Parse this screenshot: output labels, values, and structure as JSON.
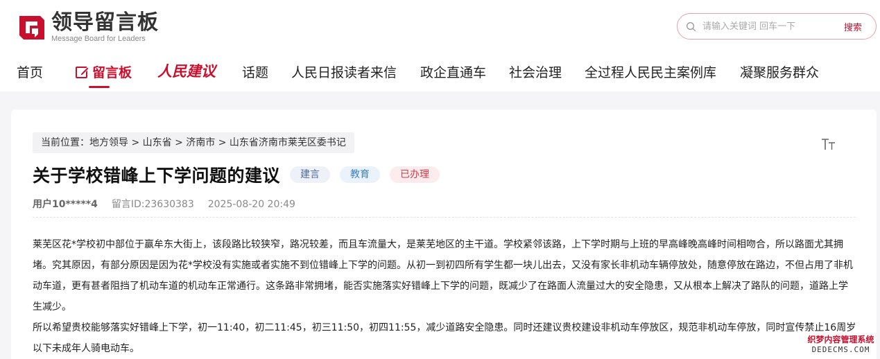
{
  "header": {
    "logo_title": "领导留言板",
    "logo_subtitle": "Message Board for Leaders",
    "search": {
      "placeholder": "请输入关键词 回车一下",
      "button": "搜索"
    }
  },
  "nav": {
    "items": [
      {
        "label": "首页"
      },
      {
        "label": "留言板",
        "active": true
      },
      {
        "label": "人民建议"
      },
      {
        "label": "话题"
      },
      {
        "label": "人民日报读者来信"
      },
      {
        "label": "政企直通车"
      },
      {
        "label": "社会治理"
      },
      {
        "label": "全过程人民民主案例库"
      },
      {
        "label": "凝聚服务群众"
      }
    ]
  },
  "breadcrumb": {
    "prefix": "当前位置：",
    "items": [
      "地方领导",
      "山东省",
      "济南市",
      "山东省济南市莱芜区委书记"
    ],
    "separator": " > "
  },
  "message": {
    "title": "关于学校错峰上下学问题的建议",
    "tags": [
      "建言",
      "教育",
      "已办理"
    ],
    "user": "用户10*****4",
    "message_id": "留言ID:23630383",
    "datetime": "2025-08-20 20:49",
    "paragraphs": [
      "莱芜区花*学校初中部位于赢牟东大街上，该段路比较狭窄，路况较差，而且车流量大，是莱芜地区的主干道。学校紧邻该路，上下学时期与上班的早高峰晚高峰时间相吻合，所以路面尤其拥堵。究其原因，有部分原因是因为花*学校没有实施或者实施不到位错峰上下学的问题。从初一到初四所有学生都一块儿出去，又没有家长非机动车辆停放处，随意停放在路边，不但占用了非机动车道，更有甚者阻挡了机动车道的机动车正常通行。这条路非常拥堵，能否实施落实好错峰上下学的问题，既减少了在路面人流量过大的安全隐患，又从根本上解决了路队的问题，道路上学生减少。",
      "所以希望贵校能够落实好错峰上下学，初一11:40，初二11:45，初三11:50，初四11:55，减少道路安全隐患。同时还建议贵校建设非机动车停放区，规范非机动车停放，同时宣传禁止16周岁以下未成年人骑电动车。"
    ]
  },
  "watermark": {
    "line1": "织梦内容管理系统",
    "line2": "DEDECMS.COM"
  },
  "colors": {
    "brand_red": "#c8102e",
    "tag_blue": "#3b7fc4",
    "tag_status_red": "#d33a4a"
  },
  "icons": {
    "logo": "message-board-logo-icon",
    "search": "search-icon",
    "pencil": "pencil-edit-icon",
    "font_size": "font-size-icon"
  }
}
